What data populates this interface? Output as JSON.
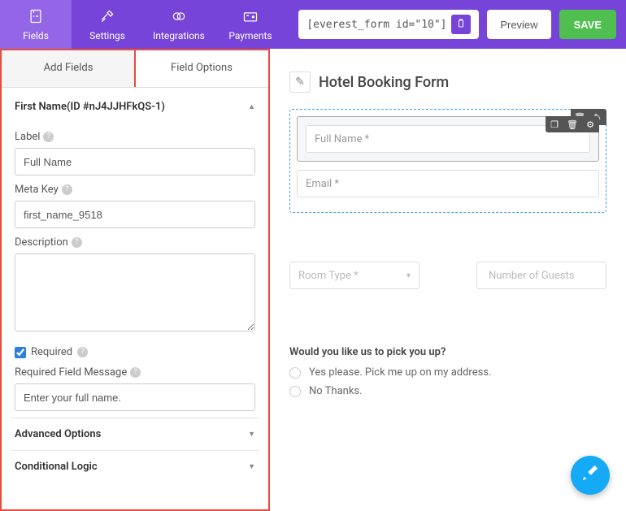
{
  "toolbar": {
    "tabs": [
      {
        "label": "Fields"
      },
      {
        "label": "Settings"
      },
      {
        "label": "Integrations"
      },
      {
        "label": "Payments"
      }
    ],
    "shortcode": "[everest_form id=\"10\"]",
    "preview": "Preview",
    "save": "SAVE"
  },
  "subTabs": {
    "addFields": "Add Fields",
    "fieldOptions": "Field Options"
  },
  "options": {
    "title": "First Name(ID #nJ4JJHFkQS-1)",
    "labelLabel": "Label",
    "labelValue": "Full Name",
    "metaKeyLabel": "Meta Key",
    "metaKeyValue": "first_name_9518",
    "descriptionLabel": "Description",
    "descriptionValue": "",
    "requiredLabel": "Required",
    "requiredMsgLabel": "Required Field Message",
    "requiredMsgValue": "Enter your full name.",
    "advanced": "Advanced Options",
    "conditional": "Conditional Logic"
  },
  "preview": {
    "formTitle": "Hotel Booking Form",
    "fullName": "Full Name *",
    "email": "Email *",
    "roomType": "Room Type *",
    "guests": "Number of Guests",
    "question": "Would you like us to pick you up?",
    "opt1": "Yes please. Pick me up on my address.",
    "opt2": "No Thanks."
  }
}
